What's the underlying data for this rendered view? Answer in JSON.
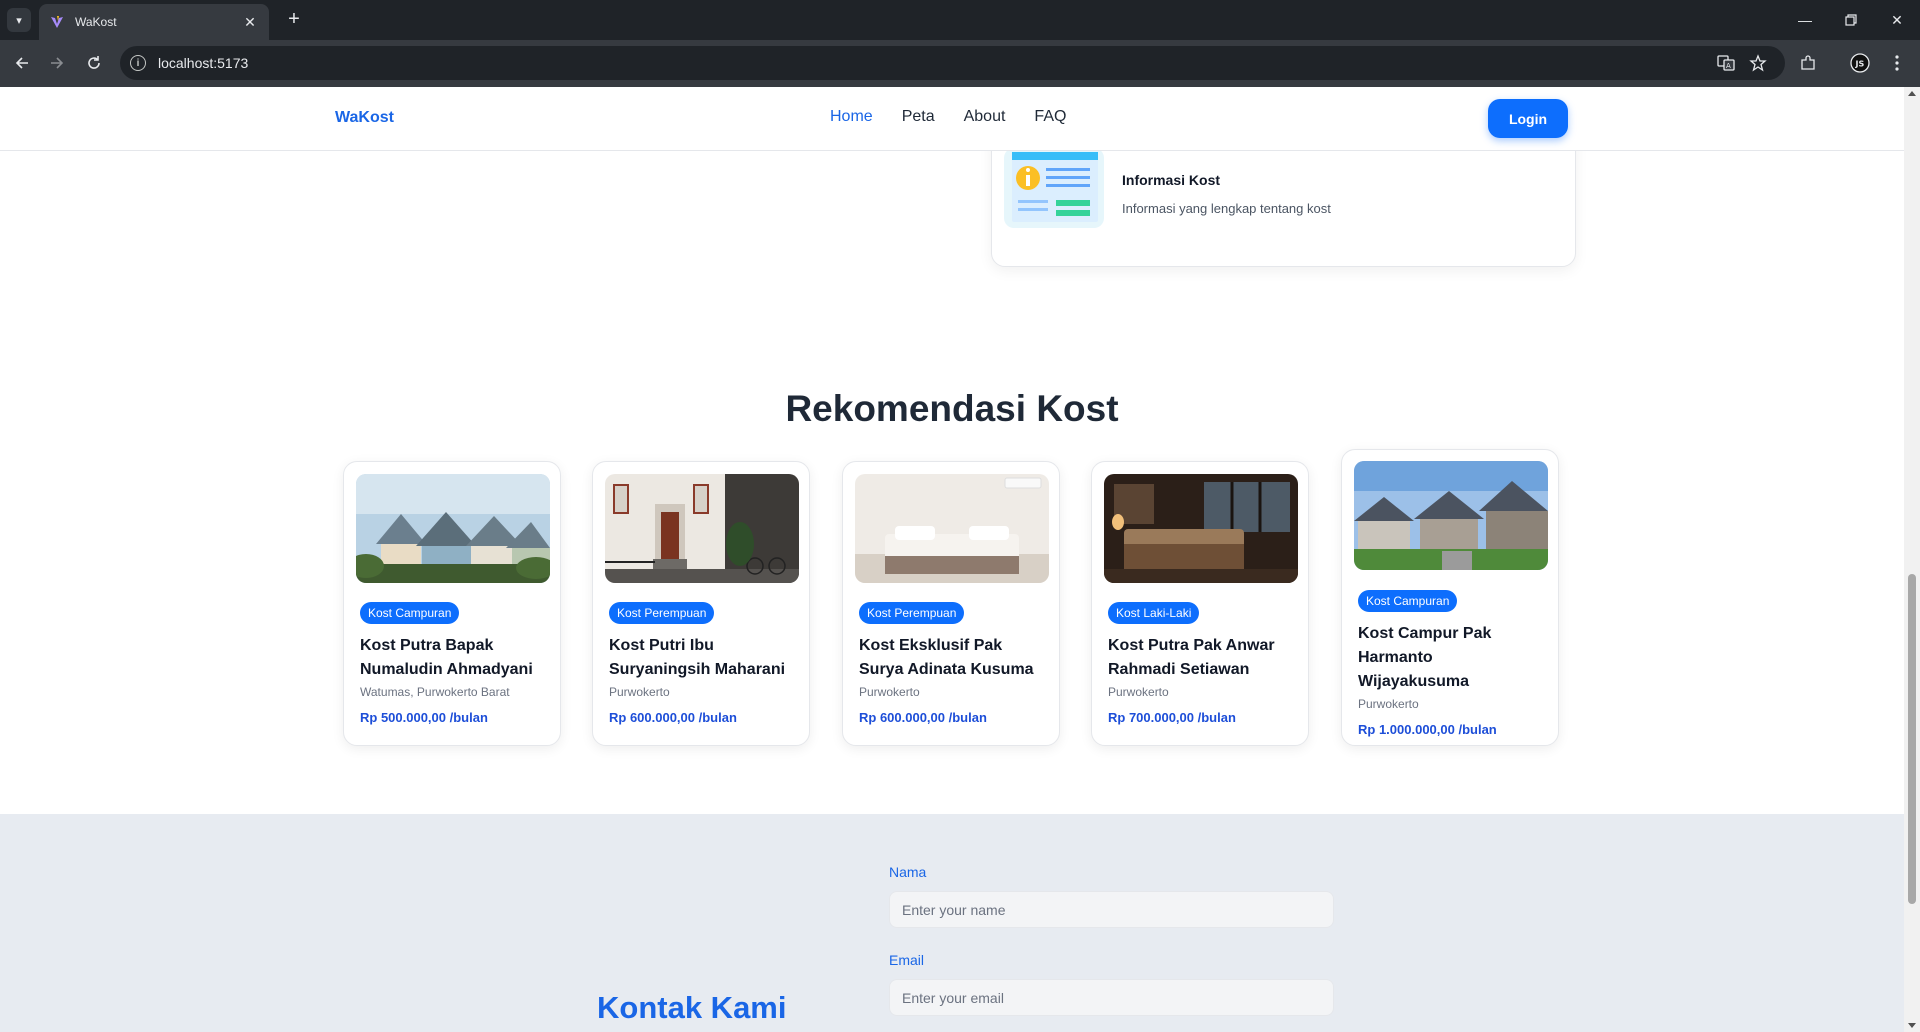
{
  "browser": {
    "tab_title": "WaKost",
    "url": "localhost:5173",
    "new_tab_icon": "plus-icon"
  },
  "nav": {
    "brand": "WaKost",
    "links": [
      "Home",
      "Peta",
      "About",
      "FAQ"
    ],
    "active_link": "Home",
    "login_label": "Login"
  },
  "info_card": {
    "title": "Informasi Kost",
    "description": "Informasi yang lengkap tentang kost"
  },
  "recommendations": {
    "title": "Rekomendasi Kost",
    "items": [
      {
        "badge": "Kost Campuran",
        "name": "Kost Putra Bapak Numaludin Ahmadyani",
        "location": "Watumas, Purwokerto Barat",
        "price": "Rp 500.000,00 /bulan"
      },
      {
        "badge": "Kost Perempuan",
        "name": "Kost Putri Ibu Suryaningsih Maharani",
        "location": "Purwokerto",
        "price": "Rp 600.000,00 /bulan"
      },
      {
        "badge": "Kost Perempuan",
        "name": "Kost Eksklusif Pak Surya Adinata Kusuma",
        "location": "Purwokerto",
        "price": "Rp 600.000,00 /bulan"
      },
      {
        "badge": "Kost Laki-Laki",
        "name": "Kost Putra Pak Anwar Rahmadi Setiawan",
        "location": "Purwokerto",
        "price": "Rp 700.000,00 /bulan"
      },
      {
        "badge": "Kost Campuran",
        "name": "Kost Campur Pak Harmanto Wijayakusuma",
        "location": "Purwokerto",
        "price": "Rp 1.000.000,00 /bulan"
      }
    ]
  },
  "contact": {
    "title": "Kontak Kami",
    "name_label": "Nama",
    "name_placeholder": "Enter your name",
    "email_label": "Email",
    "email_placeholder": "Enter your email"
  },
  "colors": {
    "accent": "#1a66e6",
    "button": "#0d6efd",
    "price": "#1d4ed8",
    "contact_bg": "#e7ebf1"
  }
}
